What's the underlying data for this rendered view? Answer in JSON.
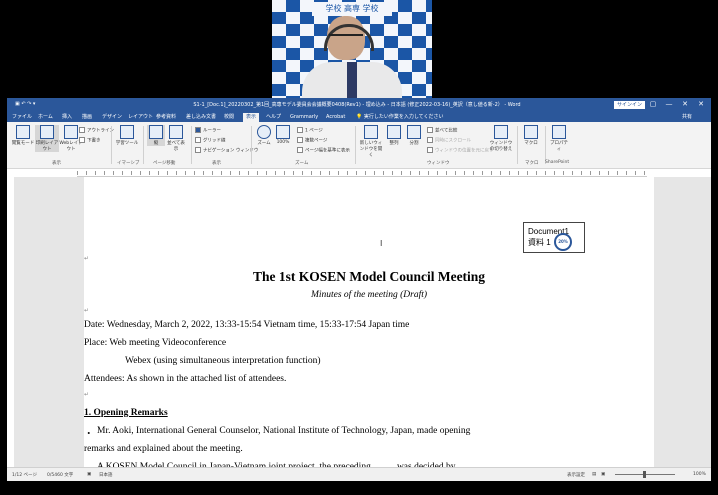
{
  "webcam": {
    "logo_text": "学校 高専 学校"
  },
  "window": {
    "title": "S1-1_[Doc.1]_20220302_第1回_高専モデル委員会会議概要0408(Rev1) - 埋め込み - 日本語 (修正2022-03-16)_英訳（意し値る新-2） - Word",
    "signin_label": "サインイン",
    "controls": [
      "—",
      "▢",
      "▭",
      "✕"
    ]
  },
  "tabs": [
    "ファイル",
    "ホーム",
    "挿入",
    "描画",
    "デザイン",
    "レイアウト",
    "参考資料",
    "差し込み文書",
    "校閲",
    "表示",
    "ヘルプ",
    "Grammarly",
    "Acrobat"
  ],
  "active_tab": "表示",
  "tell_me": "実行したい作業を入力してください",
  "share_label": "共有",
  "ribbon": {
    "views": [
      "閲覧モード",
      "印刷レイアウト",
      "Webレイアウト"
    ],
    "view_options": [
      "アウトライン",
      "下書き"
    ],
    "views_group": "表示",
    "immersive": "学習ツール",
    "immersive_group": "イマーシブ",
    "page_move": [
      "縦",
      "並べて表示"
    ],
    "page_move_group": "ページ移動",
    "show": [
      "ルーラー",
      "グリッド線",
      "ナビゲーション ウィンドウ"
    ],
    "show_group": "表示",
    "zoom": [
      "ズーム",
      "100%"
    ],
    "zoom_options": [
      "1 ページ",
      "複数ページ",
      "ページ幅を基準に表示"
    ],
    "zoom_group": "ズーム",
    "window_btns": [
      "新しいウィンドウを開く",
      "整列",
      "分割"
    ],
    "window_opts": [
      "並べて比較",
      "同時にスクロール",
      "ウィンドウの位置を元に戻す"
    ],
    "switch": "ウィンドウの切り替え",
    "window_group": "ウィンドウ",
    "macro": "マクロ",
    "macro_group": "マクロ",
    "properties": "プロパティ",
    "sharepoint_group": "SharePoint"
  },
  "doc": {
    "stamp_line1": "Document1",
    "stamp_line2": "資料 1",
    "badge": "20%",
    "title": "The 1st KOSEN Model Council Meeting",
    "subtitle": "Minutes of the meeting (Draft)",
    "date": "Date: Wednesday, March 2, 2022, 13:33-15:54 Vietnam time, 15:33-17:54 Japan time",
    "place": "Place: Web meeting Videoconference",
    "place2": "Webex (using simultaneous interpretation function)",
    "attendees": "Attendees: As shown in the attached list of attendees.",
    "section1": "1. Opening Remarks",
    "bullet": "・",
    "para1a": "Mr. Aoki, International General Counselor, National Institute of Technology, Japan, made opening",
    "para1b": "remarks and explained about the meeting.",
    "para2": "A KOSEN Model Council in Japan-Vietnam joint project, the preceding ......... was decided by"
  },
  "status": {
    "page": "1/12 ページ",
    "words": "0/5460 文字",
    "lang": "日本語",
    "display_settings": "表示設定",
    "zoom": "100%"
  }
}
